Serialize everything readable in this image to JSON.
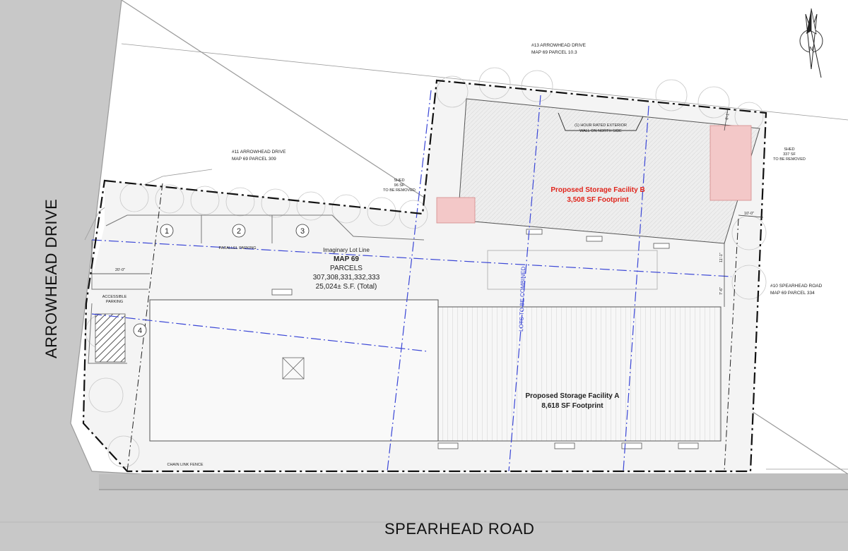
{
  "roads": {
    "arrowhead": "ARROWHEAD DRIVE",
    "spearhead": "SPEARHEAD ROAD"
  },
  "neighbors": {
    "n13": {
      "line1": "#13 ARROWHEAD DRIVE",
      "line2": "MAP 69  PARCEL 10.3"
    },
    "n11": {
      "line1": "#11 ARROWHEAD DRIVE",
      "line2": "MAP 69  PARCEL 309"
    },
    "n10": {
      "line1": "#10 SPEARHEAD ROAD",
      "line2": "MAP 69  PARCEL 334"
    }
  },
  "facility_b": {
    "title": "Proposed Storage Facility B",
    "footprint": "3,508 SF Footprint"
  },
  "facility_a": {
    "title": "Proposed Storage Facility A",
    "footprint": "8,618 SF Footprint"
  },
  "site": {
    "lot_line": "Imaginary Lot Line",
    "map": "MAP 69",
    "parcels_label": "PARCELS",
    "parcels": "307,308,331,332,333",
    "area": "25,024± S.F. (Total)",
    "lots_combined": "LOTS TO BE COMBINED"
  },
  "notes": {
    "wall1": "(1) HOUR RATED EXTERIOR",
    "wall2": "WALL ON NORTH SIDE",
    "shed_left": [
      "SHED",
      "96 SF",
      "TO BE REMOVED"
    ],
    "shed_right": [
      "SHED",
      "337 SF",
      "TO BE REMOVED"
    ],
    "parallel_parking": "PARALLEL PARKING",
    "accessible": [
      "ACCESSIBLE",
      "PARKING"
    ],
    "chain_link": "CHAIN LINK FENCE"
  },
  "dimensions": {
    "d20": "20'-0\"",
    "d10": "10'-0\"",
    "d6": "6'-1\"",
    "d11": "11'-1\"",
    "d7": "7'-6\""
  },
  "parking_spaces": [
    "1",
    "2",
    "3",
    "4"
  ],
  "colors": {
    "road": "#c7c7c7",
    "shed": "#f3c8c8",
    "lot_line": "#3a46d6",
    "proposal_text": "#e0241b"
  }
}
